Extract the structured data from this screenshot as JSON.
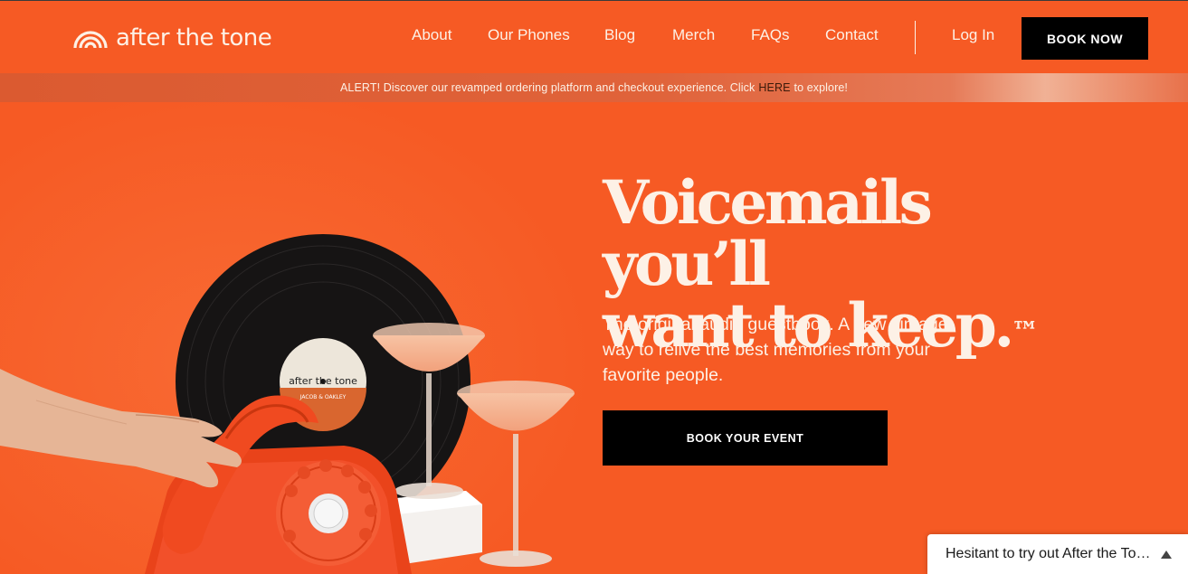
{
  "brand": {
    "name": "after the tone",
    "accent": "#F65A24",
    "cream": "#FDF1E6"
  },
  "nav": {
    "links": [
      "About",
      "Our Phones",
      "Blog",
      "Merch",
      "FAQs",
      "Contact"
    ],
    "login": "Log In",
    "cta": "BOOK NOW"
  },
  "alert": {
    "prefix": "ALERT! Discover our revamped ordering platform and checkout experience. Click",
    "link": "HERE",
    "suffix": "to explore!"
  },
  "hero": {
    "headline_line1": "Voicemails you’ll",
    "headline_line2": "want to keep.",
    "tm": "™",
    "subtext": "The original audio guestbook. A new vintage way to relive the best memories from your favorite people.",
    "cta": "BOOK YOUR EVENT",
    "record_label": "after the tone",
    "record_names": "JACOB & OAKLEY"
  },
  "chat": {
    "text": "Hesitant to try out After the Tone?",
    "icon": "chevron-up-icon"
  }
}
